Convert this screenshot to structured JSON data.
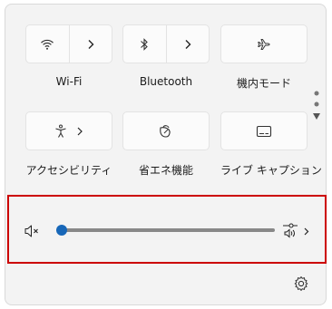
{
  "quick_settings": {
    "tiles": [
      {
        "label": "Wi-Fi",
        "icon": "wifi-icon"
      },
      {
        "label": "Bluetooth",
        "icon": "bluetooth-icon"
      },
      {
        "label": "機内モード",
        "icon": "airplane-icon"
      },
      {
        "label": "アクセシビリティ",
        "icon": "accessibility-icon"
      },
      {
        "label": "省エネ機能",
        "icon": "leaf-icon"
      },
      {
        "label": "ライブ キャプション",
        "icon": "captions-icon"
      }
    ]
  },
  "volume": {
    "muted": true,
    "level": 0,
    "mute_icon": "speaker-muted-icon",
    "output_icon": "sound-output-icon"
  },
  "footer": {
    "settings_icon": "gear-icon"
  },
  "colors": {
    "accent": "#1767b8",
    "highlight_border": "#cc0000"
  }
}
